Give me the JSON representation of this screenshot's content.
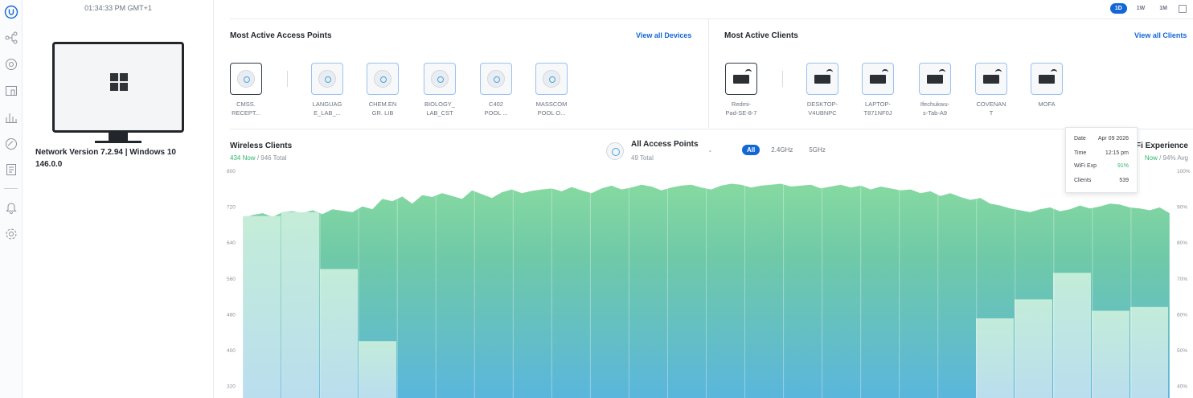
{
  "clock": "01:34:33 PM GMT+1",
  "device": {
    "title": "Network Version 7.2.94 | Windows 10 146.0.0",
    "icon": "windows-icon"
  },
  "nav": {
    "icons": [
      "ubiquiti-logo-icon",
      "topology-icon",
      "target-icon",
      "devices-icon",
      "statistics-icon",
      "insights-icon",
      "events-icon",
      "bell-icon",
      "gear-icon"
    ]
  },
  "ranges": [
    "1D",
    "1W",
    "1M"
  ],
  "access_points": {
    "title": "Most Active Access Points",
    "link": "View all Devices",
    "items": [
      {
        "label": "CMSS.\nRECEPT..."
      },
      {
        "label": "LANGUAG\nE_LAB_..."
      },
      {
        "label": "CHEM.EN\nGR. LIB"
      },
      {
        "label": "BIOLOGY_\nLAB_CST"
      },
      {
        "label": "C402\nPOOL ..."
      },
      {
        "label": "MASSCOM\nPOOL O..."
      }
    ]
  },
  "clients": {
    "title": "Most Active Clients",
    "link": "View all Clients",
    "items": [
      {
        "label": "Redmi-\nPad-SE-8-7"
      },
      {
        "label": "DESKTOP-\nV4UBNPC"
      },
      {
        "label": "LAPTOP-\nT871NF0J"
      },
      {
        "label": "Ifechukwu-\ns-Tab-A9"
      },
      {
        "label": "COVENAN\nT"
      },
      {
        "label": "MOFA"
      }
    ]
  },
  "wireless": {
    "title": "Wireless Clients",
    "now": "434 Now",
    "total": "/ 946 Total"
  },
  "ap_selector": {
    "title": "All Access Points",
    "sub": "49 Total"
  },
  "bands": [
    "All",
    "2.4GHz",
    "5GHz"
  ],
  "wifi_exp": {
    "title": "Fi Experience",
    "now": "Now",
    "avg": "/ 94% Avg"
  },
  "tooltip": {
    "date_label": "Date",
    "date": "Apr 09 2026",
    "time_label": "Time",
    "time": "12:15 pm",
    "exp_label": "WiFi Exp",
    "exp": "91%",
    "clients_label": "Clients",
    "clients": "539"
  },
  "chart_data": {
    "type": "area",
    "y_left_ticks": [
      "800",
      "720",
      "640",
      "560",
      "480",
      "400",
      "320"
    ],
    "y_right_ticks": [
      "100%",
      "90%",
      "80%",
      "70%",
      "60%",
      "50%",
      "40%"
    ],
    "ylim_left": [
      320,
      800
    ],
    "ylim_right": [
      40,
      100
    ],
    "series": [
      {
        "values": [
          700,
          706,
          710,
          702,
          712,
          714,
          710,
          716,
          708,
          718,
          715,
          712,
          724,
          718,
          740,
          735,
          745,
          730,
          748,
          744,
          752,
          746,
          740,
          758,
          750,
          742,
          754,
          760,
          752,
          757,
          760,
          762,
          756,
          765,
          758,
          752,
          762,
          768,
          760,
          764,
          770,
          766,
          758,
          764,
          768,
          770,
          764,
          760,
          768,
          772,
          770,
          764,
          768,
          770,
          772,
          766,
          768,
          770,
          762,
          766,
          770,
          764,
          768,
          760,
          766,
          762,
          758,
          760,
          752,
          756,
          746,
          752,
          744,
          738,
          742,
          730,
          726,
          720,
          716,
          712,
          718,
          722,
          714,
          718,
          726,
          720,
          724,
          730,
          728,
          722,
          720,
          716,
          722,
          710
        ]
      },
      {
        "values": [
          715,
          715,
          720,
          720,
          695,
          695,
          455,
          455,
          320,
          320,
          320,
          320,
          320,
          320,
          320,
          320,
          320,
          320,
          320,
          320,
          320,
          320,
          320,
          320,
          320,
          320,
          320,
          320,
          320,
          320,
          320,
          320,
          320,
          320,
          320,
          320,
          320,
          320,
          320,
          320,
          320,
          320,
          320,
          320,
          320,
          320,
          320,
          320,
          320,
          320,
          320,
          320,
          320,
          320,
          320,
          320,
          320,
          320,
          320,
          320,
          320,
          320,
          320,
          320,
          320,
          320,
          320,
          320,
          320,
          320,
          320,
          320,
          320,
          320,
          320,
          320,
          320,
          320,
          320,
          320,
          320,
          320,
          320,
          320,
          320,
          320,
          320,
          320,
          320,
          320,
          320,
          320,
          320,
          320
        ]
      }
    ],
    "bars_right": [
      {
        "x_frac": 0,
        "values_pct": [
          88,
          89,
          74,
          55
        ]
      },
      {
        "x_frac": 1,
        "values_pct": [
          61,
          66,
          73,
          63,
          64
        ]
      }
    ],
    "grid": true
  }
}
